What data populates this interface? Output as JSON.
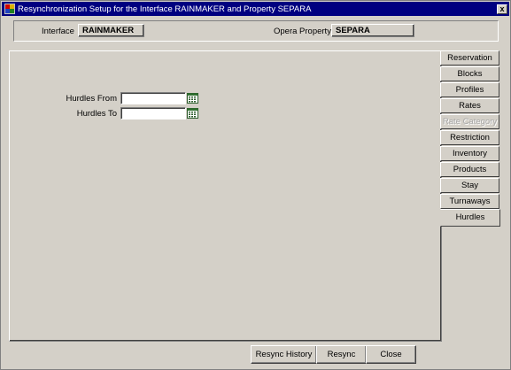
{
  "window": {
    "title": "Resynchronization Setup for the Interface RAINMAKER and Property SEPARA",
    "close_glyph": "x"
  },
  "header": {
    "interface_label": "Interface",
    "interface_value": "RAINMAKER",
    "property_label": "Opera Property",
    "property_value": "SEPARA"
  },
  "form": {
    "hurdles_from_label": "Hurdles From",
    "hurdles_from_value": "",
    "hurdles_to_label": "Hurdles To",
    "hurdles_to_value": ""
  },
  "tabs": [
    {
      "label": "Reservation",
      "state": "normal"
    },
    {
      "label": "Blocks",
      "state": "normal"
    },
    {
      "label": "Profiles",
      "state": "normal"
    },
    {
      "label": "Rates",
      "state": "normal"
    },
    {
      "label": "Rate Category",
      "state": "disabled"
    },
    {
      "label": "Restriction",
      "state": "normal"
    },
    {
      "label": "Inventory",
      "state": "normal"
    },
    {
      "label": "Products",
      "state": "normal"
    },
    {
      "label": "Stay",
      "state": "normal"
    },
    {
      "label": "Turnaways",
      "state": "normal"
    },
    {
      "label": "Hurdles",
      "state": "active"
    }
  ],
  "buttons": {
    "resync_history": "Resync History",
    "resync": "Resync",
    "close": "Close"
  },
  "colors": {
    "titlebar": "#000080",
    "face": "#d4d0c8",
    "disabled_text": "#a8a8a8"
  },
  "icons": {
    "app": "oracle-app-icon",
    "calendar": "calendar-icon"
  }
}
